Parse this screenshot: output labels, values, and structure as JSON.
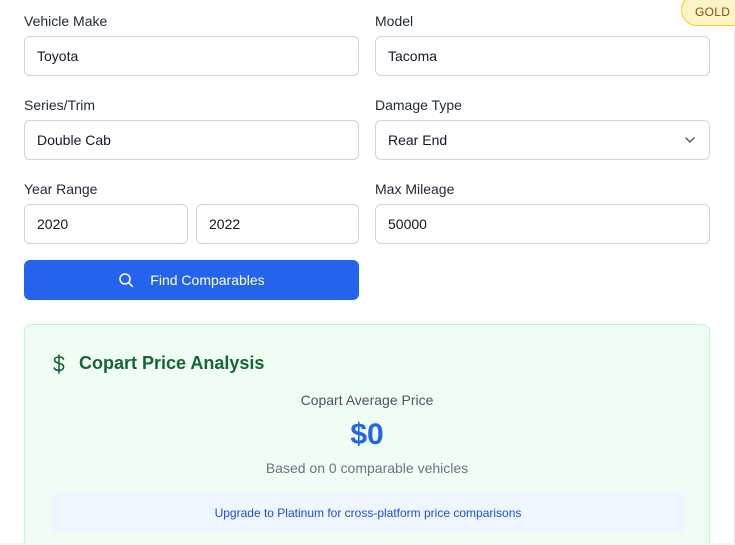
{
  "form": {
    "make": {
      "label": "Vehicle Make",
      "value": "Toyota"
    },
    "model": {
      "label": "Model",
      "value": "Tacoma"
    },
    "trim": {
      "label": "Series/Trim",
      "value": "Double Cab"
    },
    "damage": {
      "label": "Damage Type",
      "value": "Rear End"
    },
    "year": {
      "label": "Year Range",
      "from": "2020",
      "to": "2022"
    },
    "mileage": {
      "label": "Max Mileage",
      "value": "50000"
    },
    "find_label": "Find Comparables"
  },
  "badge": {
    "text": "GOLD"
  },
  "analysis": {
    "title": "Copart Price Analysis",
    "avg_label": "Copart Average Price",
    "avg_price": "$0",
    "basis": "Based on 0 comparable vehicles",
    "upgrade": "Upgrade to Platinum for cross-platform price comparisons"
  },
  "colors": {
    "primary": "#2563eb",
    "panel_bg": "#f0fdf4",
    "panel_title": "#166534",
    "badge_bg": "#fef3c7"
  }
}
